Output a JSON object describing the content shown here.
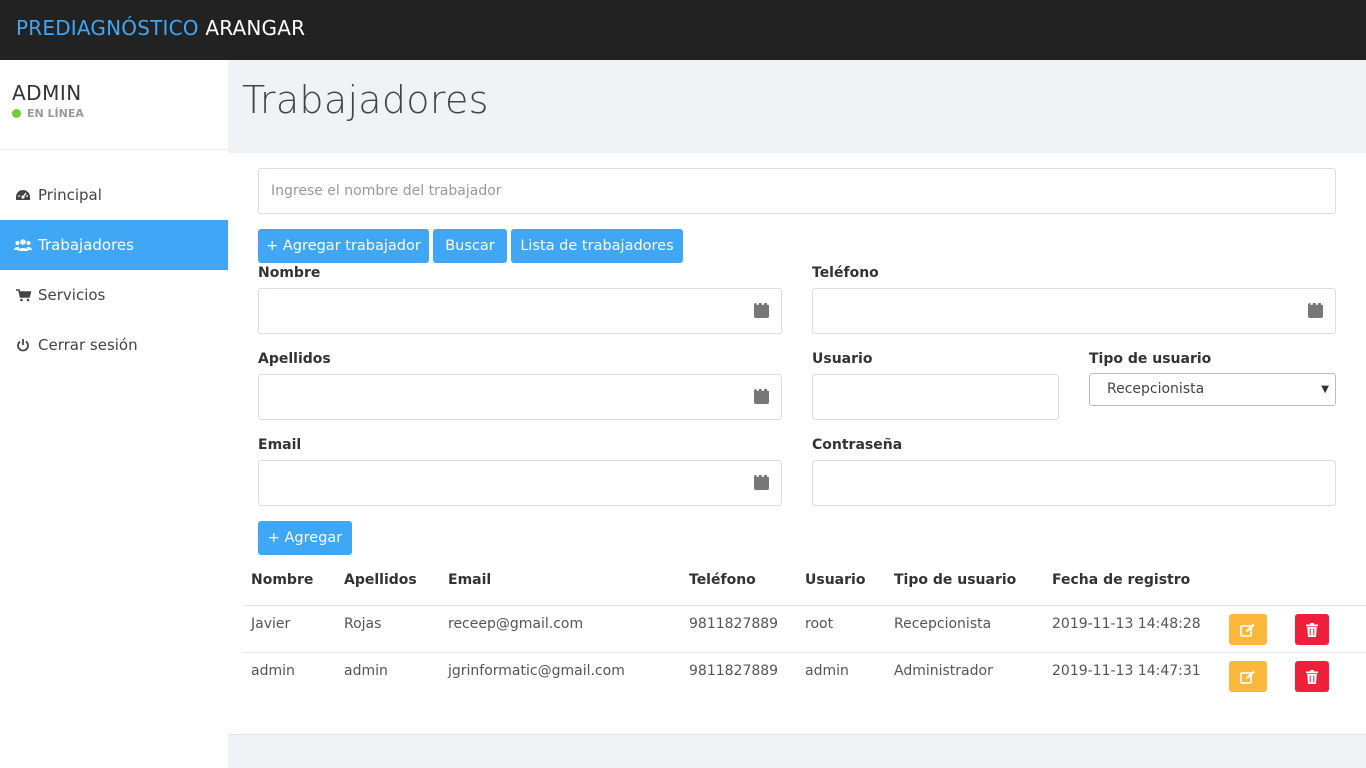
{
  "brand": {
    "part1": "PREDIAGNÓSTICO",
    "part2": "ARANGAR"
  },
  "user": {
    "name": "ADMIN",
    "status": "EN LÍNEA"
  },
  "nav": [
    {
      "label": "Principal",
      "icon": "dashboard-icon"
    },
    {
      "label": "Trabajadores",
      "icon": "users-icon",
      "active": true
    },
    {
      "label": "Servicios",
      "icon": "cart-icon"
    },
    {
      "label": "Cerrar sesión",
      "icon": "power-icon"
    }
  ],
  "page": {
    "title": "Trabajadores"
  },
  "search": {
    "placeholder": "Ingrese el nombre del trabajador",
    "value": ""
  },
  "buttons": {
    "add_worker": "+ Agregar trabajador",
    "search": "Buscar",
    "list": "Lista de trabajadores",
    "add": "+ Agregar"
  },
  "form": {
    "nombre": "Nombre",
    "telefono": "Teléfono",
    "apellidos": "Apellidos",
    "usuario": "Usuario",
    "tipo_usuario": "Tipo de usuario",
    "tipo_usuario_value": "Recepcionista",
    "email": "Email",
    "contrasena": "Contraseña"
  },
  "table": {
    "headers": [
      "Nombre",
      "Apellidos",
      "Email",
      "Teléfono",
      "Usuario",
      "Tipo de usuario",
      "Fecha de registro"
    ],
    "rows": [
      [
        "Javier",
        "Rojas",
        "receep@gmail.com",
        "9811827889",
        "root",
        "Recepcionista",
        "2019-11-13 14:48:28"
      ],
      [
        "admin",
        "admin",
        "jgrinformatic@gmail.com",
        "9811827889",
        "admin",
        "Administrador",
        "2019-11-13 14:47:31"
      ]
    ]
  },
  "colors": {
    "accent": "#3fa7f5",
    "topbar": "#222222",
    "edit": "#fdb73b",
    "delete": "#f01f3b",
    "online": "#6ad12f"
  }
}
